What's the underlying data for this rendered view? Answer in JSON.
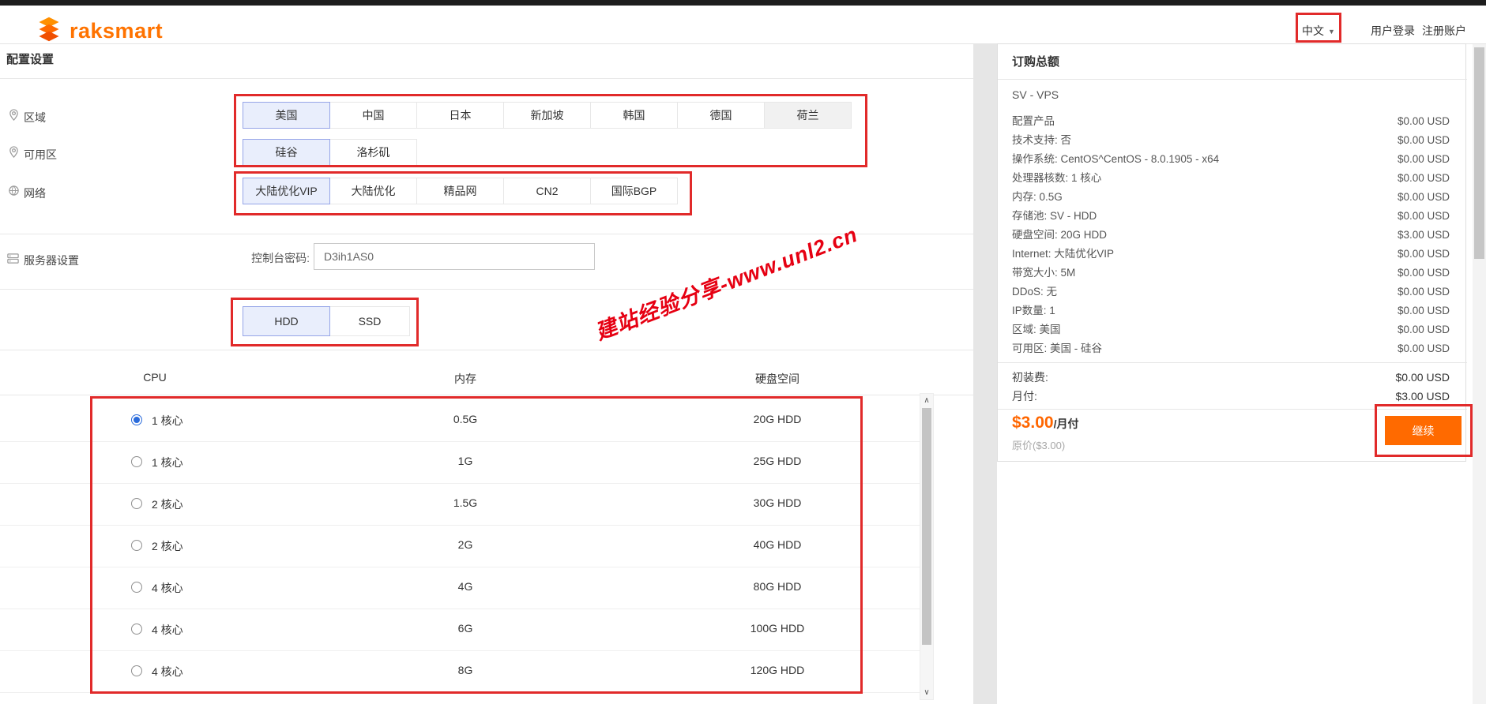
{
  "header": {
    "brand": "raksmart",
    "language": "中文",
    "login": "用户登录",
    "register": "注册账户"
  },
  "page": {
    "title": "配置设置"
  },
  "config": {
    "region": {
      "label": "区域",
      "options": [
        "美国",
        "中国",
        "日本",
        "新加坡",
        "韩国",
        "德国",
        "荷兰"
      ],
      "selected": "美国"
    },
    "zone": {
      "label": "可用区",
      "options": [
        "硅谷",
        "洛杉矶"
      ],
      "selected": "硅谷"
    },
    "network": {
      "label": "网络",
      "options": [
        "大陆优化VIP",
        "大陆优化",
        "精品网",
        "CN2",
        "国际BGP"
      ],
      "selected": "大陆优化VIP"
    },
    "server": {
      "label": "服务器设置",
      "password_label": "控制台密码:",
      "password_value": "D3ih1AS0"
    },
    "disk_type": {
      "options": [
        "HDD",
        "SSD"
      ],
      "selected": "HDD"
    }
  },
  "plans": {
    "columns": [
      "CPU",
      "内存",
      "硬盘空间"
    ],
    "rows": [
      {
        "cpu": "1 核心",
        "ram": "0.5G",
        "disk": "20G HDD",
        "selected": true
      },
      {
        "cpu": "1 核心",
        "ram": "1G",
        "disk": "25G HDD",
        "selected": false
      },
      {
        "cpu": "2 核心",
        "ram": "1.5G",
        "disk": "30G HDD",
        "selected": false
      },
      {
        "cpu": "2 核心",
        "ram": "2G",
        "disk": "40G HDD",
        "selected": false
      },
      {
        "cpu": "4 核心",
        "ram": "4G",
        "disk": "80G HDD",
        "selected": false
      },
      {
        "cpu": "4 核心",
        "ram": "6G",
        "disk": "100G HDD",
        "selected": false
      },
      {
        "cpu": "4 核心",
        "ram": "8G",
        "disk": "120G HDD",
        "selected": false
      }
    ]
  },
  "summary": {
    "title": "订购总额",
    "product": "SV - VPS",
    "items": [
      {
        "label": "配置产品",
        "price": "$0.00 USD"
      },
      {
        "label": "技术支持: 否",
        "price": "$0.00 USD"
      },
      {
        "label": "操作系统: CentOS^CentOS - 8.0.1905 - x64",
        "price": "$0.00 USD"
      },
      {
        "label": "处理器核数: 1 核心",
        "price": "$0.00 USD"
      },
      {
        "label": "内存: 0.5G",
        "price": "$0.00 USD"
      },
      {
        "label": "存储池: SV - HDD",
        "price": "$0.00 USD"
      },
      {
        "label": "硬盘空间: 20G HDD",
        "price": "$3.00 USD"
      },
      {
        "label": "Internet: 大陆优化VIP",
        "price": "$0.00 USD"
      },
      {
        "label": "带宽大小: 5M",
        "price": "$0.00 USD"
      },
      {
        "label": "DDoS: 无",
        "price": "$0.00 USD"
      },
      {
        "label": "IP数量: 1",
        "price": "$0.00 USD"
      },
      {
        "label": "区域: 美国",
        "price": "$0.00 USD"
      },
      {
        "label": "可用区: 美国 - 硅谷",
        "price": "$0.00 USD"
      }
    ],
    "totals": [
      {
        "label": "初装费:",
        "price": "$0.00 USD"
      },
      {
        "label": "月付:",
        "price": "$3.00 USD"
      }
    ],
    "price_big": "$3.00",
    "price_suffix": "/月付",
    "original_price": "原价($3.00)",
    "continue_label": "继续"
  },
  "watermark": "建站经验分享-www.unl2.cn",
  "colors": {
    "accent": "#ff6600",
    "annotation": "#e12a2a",
    "selected_bg": "#e9eefc",
    "selected_border": "#96a5e8",
    "topbar": "#1d1d1d"
  }
}
